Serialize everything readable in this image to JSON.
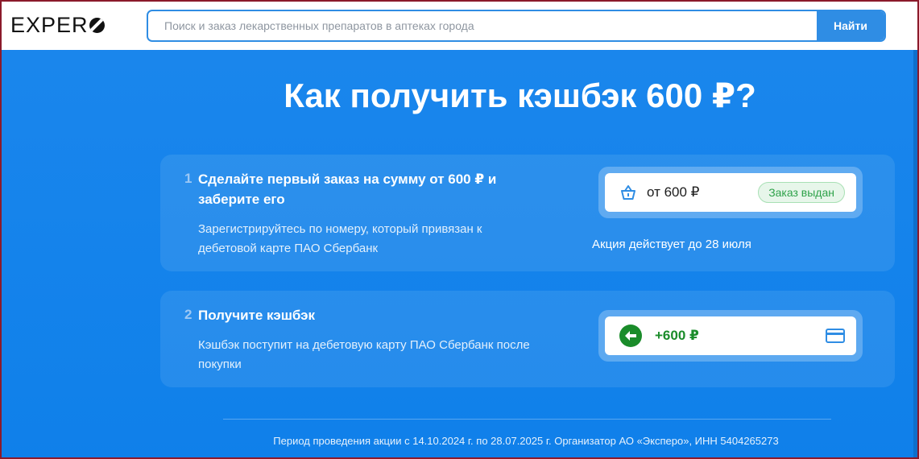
{
  "header": {
    "logo_text": "EXPER",
    "search_placeholder": "Поиск и заказ лекарственных препаратов в аптеках города",
    "search_button": "Найти"
  },
  "main": {
    "title": "Как получить кэшбэк 600 ₽?",
    "steps": [
      {
        "number": "1",
        "title": "Сделайте первый заказ на сумму от 600 ₽ и заберите его",
        "description": "Зарегистрируйтесь по номеру, который привязан к дебетовой карте ПАО Сбербанк",
        "widget_amount": "от 600 ₽",
        "widget_badge": "Заказ выдан",
        "note": "Акция действует до 28 июля"
      },
      {
        "number": "2",
        "title": "Получите кэшбэк",
        "description": "Кэшбэк поступит на дебетовую карту ПАО Сбербанк после покупки",
        "widget_amount": "+600 ₽"
      }
    ],
    "footer": "Период проведения акции с 14.10.2024 г. по 28.07.2025 г. Организатор АО «Эксперо», ИНН 5404265273"
  },
  "colors": {
    "brand_blue": "#2f8de4",
    "background_blue": "#1a86ec",
    "success_green": "#1a8c2a"
  },
  "icons": {
    "logo_mark": "logo-mark-icon",
    "basket": "basket-icon",
    "arrow": "arrow-left-icon",
    "card": "credit-card-icon"
  }
}
